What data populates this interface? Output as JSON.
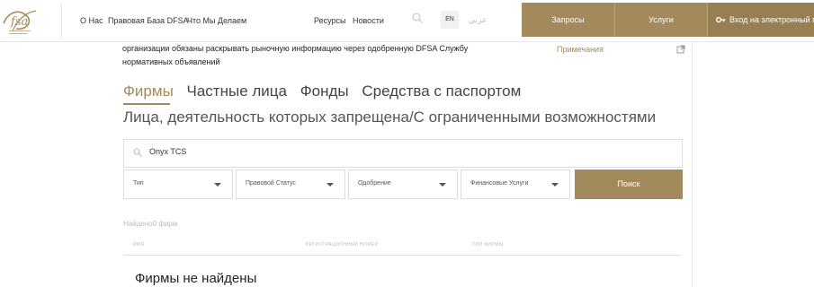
{
  "header": {
    "nav": [
      "О Нас",
      "Правовая База DFSA",
      "Что Мы Делаем",
      "Ресурсы",
      "Новости"
    ],
    "lang_en": "EN",
    "lang_ar": "عربي",
    "tabs": [
      "Запросы",
      "Услуги"
    ],
    "login": "Вход на электронный портал"
  },
  "intro": {
    "text": "организации обязаны раскрывать рыночную информацию через одобренную DFSA Службу нормативных объявлений",
    "notes_link": "Примечания"
  },
  "category_tabs": [
    "Фирмы",
    "Частные лица",
    "Фонды",
    "Средства с паспортом"
  ],
  "heading": "Лица, деятельность которых запрещена/С ограниченными возможностями",
  "search": {
    "value": "Onyx TCS"
  },
  "filters": [
    "Тип",
    "Правовой Статус",
    "Одобрение",
    "Финансовые Услуги"
  ],
  "search_button": "Поиск",
  "results": {
    "found_text": "Найдено0 фирм",
    "columns": [
      "ИМЯ",
      "РЕГИСТРАЦИОННЫЙ НОМЕР",
      "ТИП ФИРМЫ"
    ],
    "empty_message": "Фирмы не найдены"
  },
  "colors": {
    "accent": "#a38a5c"
  },
  "icons": [
    "dfsa-logo",
    "search-icon",
    "key-icon",
    "external-link-icon",
    "chevron-down-icon"
  ]
}
